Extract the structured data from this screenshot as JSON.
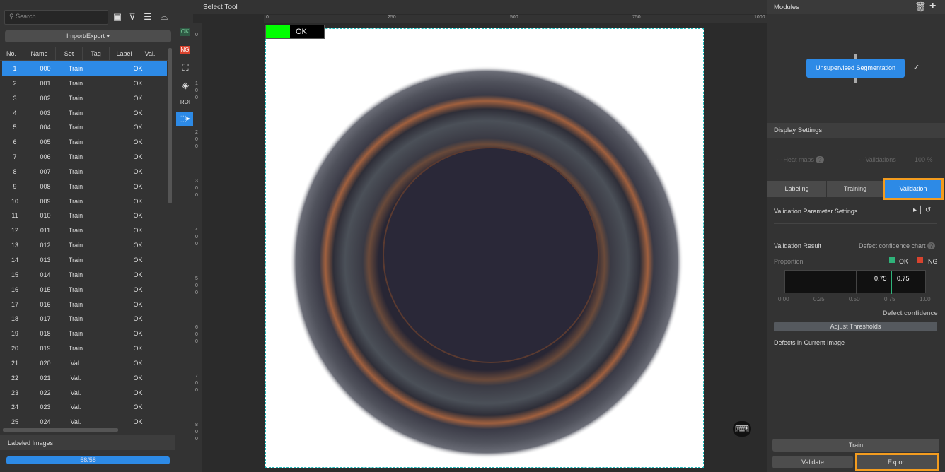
{
  "left_panel": {
    "search_placeholder": "Search",
    "import_export": "Import/Export ▾",
    "columns": [
      "No.",
      "Name",
      "Set",
      "Tag",
      "Label",
      "Val."
    ],
    "rows": [
      [
        "1",
        "000",
        "Train",
        "",
        "OK"
      ],
      [
        "2",
        "001",
        "Train",
        "",
        "OK"
      ],
      [
        "3",
        "002",
        "Train",
        "",
        "OK"
      ],
      [
        "4",
        "003",
        "Train",
        "",
        "OK"
      ],
      [
        "5",
        "004",
        "Train",
        "",
        "OK"
      ],
      [
        "6",
        "005",
        "Train",
        "",
        "OK"
      ],
      [
        "7",
        "006",
        "Train",
        "",
        "OK"
      ],
      [
        "8",
        "007",
        "Train",
        "",
        "OK"
      ],
      [
        "9",
        "008",
        "Train",
        "",
        "OK"
      ],
      [
        "10",
        "009",
        "Train",
        "",
        "OK"
      ],
      [
        "11",
        "010",
        "Train",
        "",
        "OK"
      ],
      [
        "12",
        "011",
        "Train",
        "",
        "OK"
      ],
      [
        "13",
        "012",
        "Train",
        "",
        "OK"
      ],
      [
        "14",
        "013",
        "Train",
        "",
        "OK"
      ],
      [
        "15",
        "014",
        "Train",
        "",
        "OK"
      ],
      [
        "16",
        "015",
        "Train",
        "",
        "OK"
      ],
      [
        "17",
        "016",
        "Train",
        "",
        "OK"
      ],
      [
        "18",
        "017",
        "Train",
        "",
        "OK"
      ],
      [
        "19",
        "018",
        "Train",
        "",
        "OK"
      ],
      [
        "20",
        "019",
        "Train",
        "",
        "OK"
      ],
      [
        "21",
        "020",
        "Val.",
        "",
        "OK"
      ],
      [
        "22",
        "021",
        "Val.",
        "",
        "OK"
      ],
      [
        "23",
        "022",
        "Val.",
        "",
        "OK"
      ],
      [
        "24",
        "023",
        "Val.",
        "",
        "OK"
      ],
      [
        "25",
        "024",
        "Val.",
        "",
        "OK"
      ]
    ],
    "selected_row": 0,
    "labeled_images": "Labeled Images",
    "progress_text": "58/58",
    "progress_fraction": 1.0
  },
  "toolbar": {
    "ok": "OK",
    "ng": "NG",
    "roi": "ROI"
  },
  "canvas": {
    "title": "Select Tool",
    "ruler_top": [
      "0",
      "250",
      "500",
      "750",
      "1000"
    ],
    "ruler_left": [
      "0",
      "100",
      "200",
      "300",
      "400",
      "500",
      "600",
      "700",
      "800"
    ],
    "image_label": "OK",
    "accent": "#00ff00"
  },
  "right_panel": {
    "modules": "Modules",
    "module_node": "Unsupervised Segmentation",
    "display_settings": "Display Settings",
    "heat_maps": "Heat maps",
    "validations": "Validations",
    "validations_pct": "100 %",
    "tabs": [
      "Labeling",
      "Training",
      "Validation"
    ],
    "active_tab": 2,
    "param_settings": "Validation Parameter Settings",
    "validation_result": "Validation Result",
    "defect_chart": "Defect confidence chart",
    "proportion": "Proportion",
    "legend_ok": "OK",
    "legend_ng": "NG",
    "threshold_left": "0.75",
    "threshold_right": "0.75",
    "ticks": [
      "0.00",
      "0.25",
      "0.50",
      "0.75",
      "1.00"
    ],
    "axis_label": "Defect confidence",
    "adjust": "Adjust Thresholds",
    "defects": "Defects in Current Image",
    "train": "Train",
    "validate": "Validate",
    "export": "Export",
    "highlight": "#f39c1f",
    "ok_color": "#2fb37a",
    "ng_color": "#d9432e"
  }
}
